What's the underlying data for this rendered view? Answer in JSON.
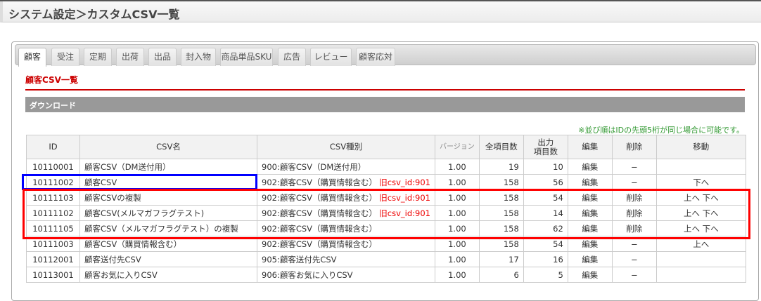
{
  "header": {
    "title": "システム設定＞カスタムCSV一覧"
  },
  "tabs": [
    "顧客",
    "受注",
    "定期",
    "出荷",
    "出品",
    "封入物",
    "商品単品SKU",
    "広告",
    "レビュー",
    "顧客応対"
  ],
  "section": {
    "heading": "顧客CSV一覧",
    "download_label": "ダウンロード",
    "note": "※並び順はIDの先頭5桁が同じ場合に可能です。"
  },
  "table": {
    "headers": {
      "id": "ID",
      "name": "CSV名",
      "type": "CSV種別",
      "version": "バージョン",
      "total": "全項目数",
      "output1": "出力",
      "output2": "項目数",
      "edit": "編集",
      "delete": "削除",
      "move": "移動"
    },
    "rows": [
      {
        "id": "10110001",
        "name": "顧客CSV（DM送付用）",
        "type": "900:顧客CSV（DM送付用）",
        "old": "",
        "version": "1.00",
        "total": "19",
        "output": "10",
        "edit": "編集",
        "delete": "−",
        "move": ""
      },
      {
        "id": "10111002",
        "name": "顧客CSV",
        "type": "902:顧客CSV（購買情報含む）",
        "old": "旧csv_id:901",
        "version": "1.00",
        "total": "158",
        "output": "56",
        "edit": "編集",
        "delete": "−",
        "move": "下へ"
      },
      {
        "id": "10111103",
        "name": "顧客CSVの複製",
        "type": "902:顧客CSV（購買情報含む）",
        "old": "旧csv_id:901",
        "version": "1.00",
        "total": "158",
        "output": "54",
        "edit": "編集",
        "delete": "削除",
        "move": "上へ 下へ"
      },
      {
        "id": "10111102",
        "name": "顧客CSV(メルマガフラグテスト)",
        "type": "902:顧客CSV（購買情報含む）",
        "old": "旧csv_id:901",
        "version": "1.00",
        "total": "158",
        "output": "14",
        "edit": "編集",
        "delete": "削除",
        "move": "上へ 下へ"
      },
      {
        "id": "10111105",
        "name": "顧客CSV（メルマガフラグテスト）の複製",
        "type": "902:顧客CSV（購買情報含む）",
        "old": "",
        "version": "1.00",
        "total": "158",
        "output": "62",
        "edit": "編集",
        "delete": "削除",
        "move": "上へ 下へ"
      },
      {
        "id": "10111003",
        "name": "顧客CSV（購買情報含む）",
        "type": "902:顧客CSV（購買情報含む）",
        "old": "",
        "version": "1.00",
        "total": "158",
        "output": "54",
        "edit": "編集",
        "delete": "−",
        "move": "上へ"
      },
      {
        "id": "10112001",
        "name": "顧客送付先CSV",
        "type": "905:顧客送付先CSV",
        "old": "",
        "version": "1.00",
        "total": "17",
        "output": "16",
        "edit": "編集",
        "delete": "−",
        "move": ""
      },
      {
        "id": "10113001",
        "name": "顧客お気に入りCSV",
        "type": "906:顧客お気に入りCSV",
        "old": "",
        "version": "1.00",
        "total": "6",
        "output": "5",
        "edit": "編集",
        "delete": "−",
        "move": ""
      }
    ]
  },
  "colors": {
    "accent": "#cc0000",
    "highlight_blue": "#0000ff",
    "highlight_red": "#ff0000"
  }
}
